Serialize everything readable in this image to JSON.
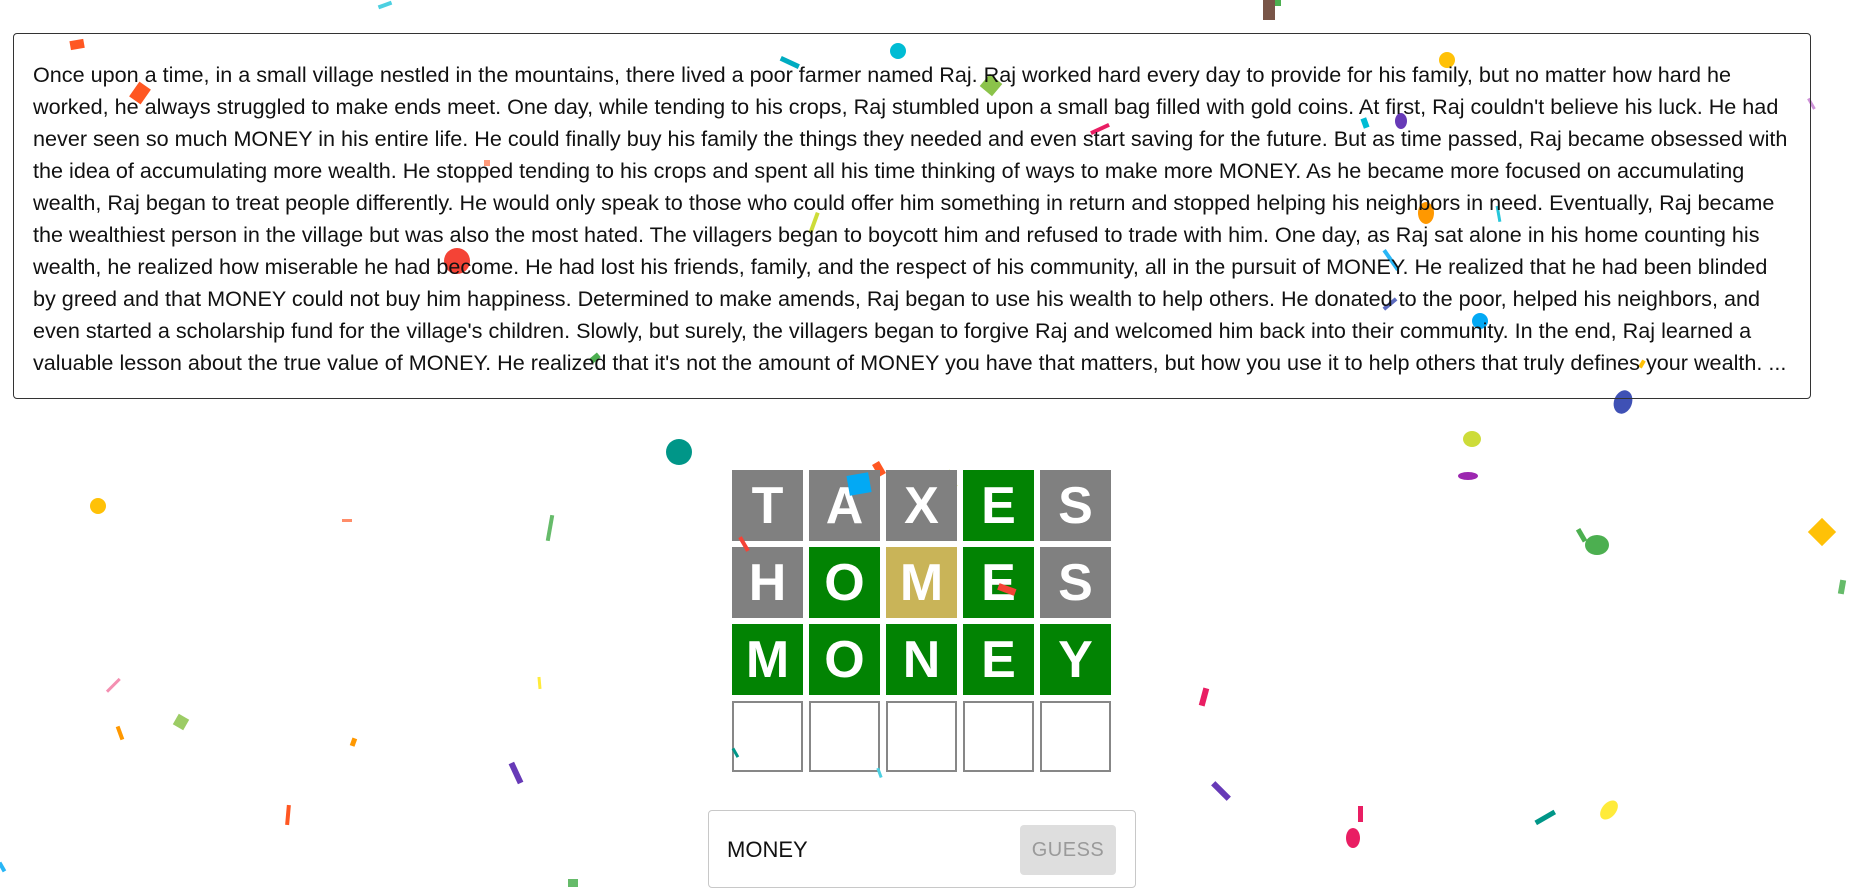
{
  "story": {
    "text": "Once upon a time, in a small village nestled in the mountains, there lived a poor farmer named Raj. Raj worked hard every day to provide for his family, but no matter how hard he worked, he always struggled to make ends meet. One day, while tending to his crops, Raj stumbled upon a small bag filled with gold coins. At first, Raj couldn't believe his luck. He had never seen so much MONEY in his entire life. He could finally buy his family the things they needed and even start saving for the future. But as time passed, Raj became obsessed with the idea of accumulating more wealth. He stopped tending to his crops and spent all his time thinking of ways to make more MONEY. As he became more focused on accumulating wealth, Raj began to treat people differently. He would only speak to those who could offer him something in return and stopped helping his neighbors in need. Eventually, Raj became the wealthiest person in the village but was also the most hated. The villagers began to boycott him and refused to trade with him. One day, as Raj sat alone in his home counting his wealth, he realized how miserable he had become. He had lost his friends, family, and the respect of his community, all in the pursuit of MONEY. He realized that he had been blinded by greed and that MONEY could not buy him happiness. Determined to make amends, Raj began to use his wealth to help others. He donated to the poor, helped his neighbors, and even started a scholarship fund for the village's children. Slowly, but surely, the villagers began to forgive Raj and welcomed him back into their community. In the end, Raj learned a valuable lesson about the true value of MONEY. He realized that it's not the amount of MONEY you have that matters, but how you use it to help others that truly defines your wealth. ..."
  },
  "board": {
    "rows": [
      {
        "tiles": [
          {
            "letter": "T",
            "state": "gray"
          },
          {
            "letter": "A",
            "state": "gray"
          },
          {
            "letter": "X",
            "state": "gray"
          },
          {
            "letter": "E",
            "state": "green"
          },
          {
            "letter": "S",
            "state": "gray"
          }
        ]
      },
      {
        "tiles": [
          {
            "letter": "H",
            "state": "gray"
          },
          {
            "letter": "O",
            "state": "green"
          },
          {
            "letter": "M",
            "state": "yellow"
          },
          {
            "letter": "E",
            "state": "green"
          },
          {
            "letter": "S",
            "state": "gray"
          }
        ]
      },
      {
        "tiles": [
          {
            "letter": "M",
            "state": "green"
          },
          {
            "letter": "O",
            "state": "green"
          },
          {
            "letter": "N",
            "state": "green"
          },
          {
            "letter": "E",
            "state": "green"
          },
          {
            "letter": "Y",
            "state": "green"
          }
        ]
      },
      {
        "tiles": [
          {
            "letter": "",
            "state": "empty"
          },
          {
            "letter": "",
            "state": "empty"
          },
          {
            "letter": "",
            "state": "empty"
          },
          {
            "letter": "",
            "state": "empty"
          },
          {
            "letter": "",
            "state": "empty"
          }
        ]
      }
    ]
  },
  "guess_form": {
    "input_value": "MONEY",
    "button_label": "GUESS"
  },
  "colors": {
    "correct": "#028303",
    "present": "#c9b458",
    "absent": "#808080",
    "empty_border": "#878787"
  }
}
